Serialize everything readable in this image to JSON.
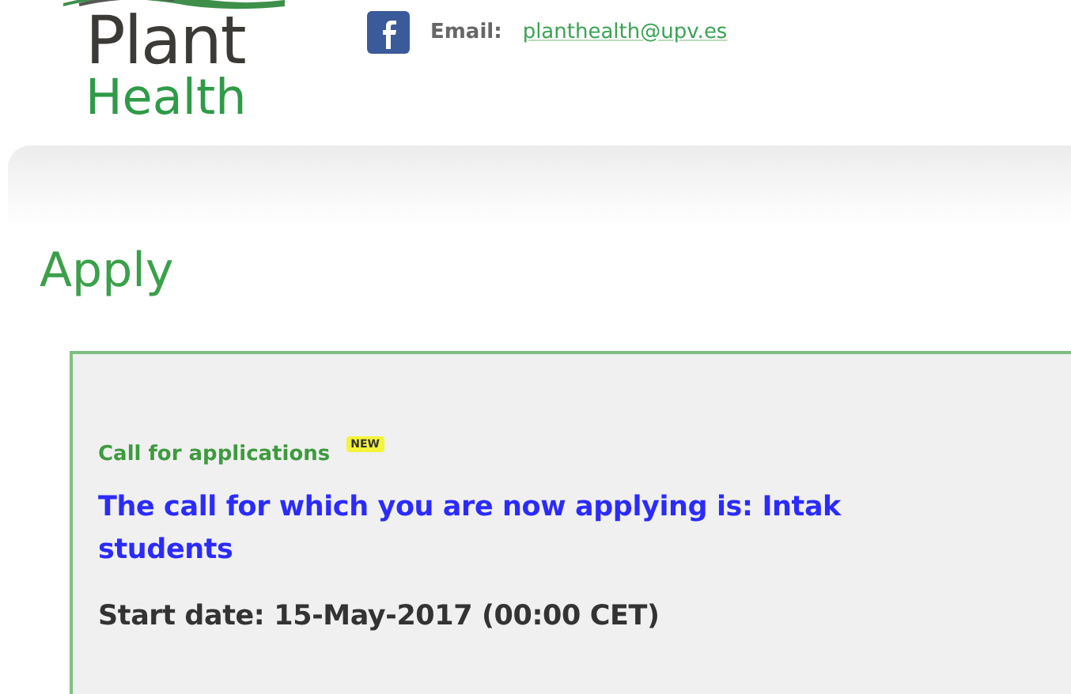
{
  "logo": {
    "line_1": "Plant",
    "line_2": "Health"
  },
  "contact": {
    "email_label": "Email:",
    "email": "planthealth@upv.es"
  },
  "page_title": "Apply",
  "call": {
    "heading": "Call for applications",
    "badge": "NEW",
    "description": "The call for which you are now applying is: Intak\nstudents",
    "start_date": "Start date: 15-May-2017 (00:00 CET)"
  }
}
